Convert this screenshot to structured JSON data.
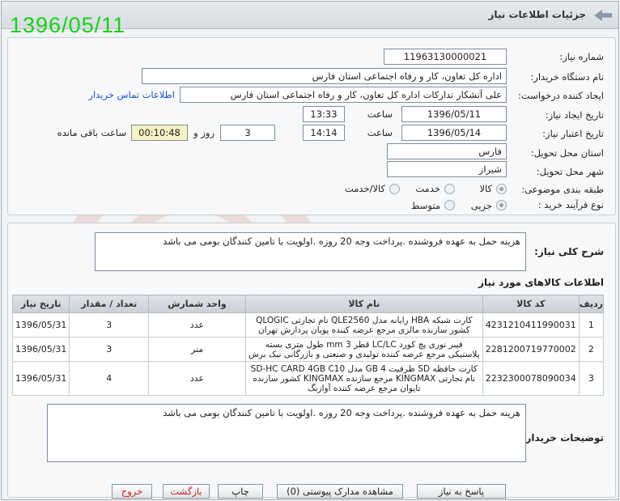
{
  "header": {
    "title": "جزئیات اطلاعات نیاز"
  },
  "date_stamp": "1396/05/11",
  "fields": {
    "need_number": {
      "label": "شماره نیاز:",
      "value": "11963130000021"
    },
    "buyer_org": {
      "label": "نام دستگاه خریدار:",
      "value": "اداره کل تعاون، کار و رفاه اجتماعی استان فارس"
    },
    "requester": {
      "label": "ایجاد کننده درخواست:",
      "value": "علی آتشکار تدارکات اداره کل تعاون، کار و رفاه اجتماعی استان فارس",
      "contact_link": "اطلاعات تماس خریدار"
    },
    "announce_date": {
      "label": "تاریخ ایجاد نیاز:",
      "date": "1396/05/11",
      "time_label": "ساعت",
      "time": "13:33"
    },
    "deadline": {
      "label": "تاریخ اعتبار نیاز:",
      "date": "1396/05/14",
      "time_label": "ساعت",
      "time": "14:14",
      "days": "3",
      "days_label": "روز و",
      "remaining": "00:10:48",
      "remaining_label": "ساعت باقی مانده"
    },
    "province": {
      "label": "استان محل تحویل:",
      "value": "فارس"
    },
    "city": {
      "label": "شهر محل تحویل:",
      "value": "شیراز"
    },
    "category": {
      "label": "طبقه بندی موضوعی:",
      "options": [
        "کالا",
        "خدمت",
        "کالا/خدمت"
      ],
      "selected": "کالا"
    },
    "process": {
      "label": "نوع فرآیند خرید :",
      "options": [
        "جزیی",
        "متوسط"
      ],
      "selected": "جزیی"
    }
  },
  "summary": {
    "label": "شرح کلی نیاز:",
    "text": "هزینه حمل به عهده فروشنده .پرداخت وجه 20 روزه .اولویت با تامین کنندگان بومی می باشد"
  },
  "items_title": "اطلاعات کالاهای مورد نیاز",
  "table": {
    "headers": [
      "ردیف",
      "کد کالا",
      "نام کالا",
      "واحد شمارش",
      "تعداد / مقدار",
      "تاریخ نیاز"
    ],
    "rows": [
      [
        "1",
        "4231210411990031",
        "کارت شبکه HBA رایانه مدل QLE2560 نام تجارتی QLOGIC کشور سازنده مالزی مرجع عرضه کننده پویان پردازش تهران",
        "عدد",
        "3",
        "1396/05/31"
      ],
      [
        "2",
        "2281200719770002",
        "فیبر نوری پچ کورد LC/LC قطر 3 mm طول متری بسته پلاستیکی مرجع عرضه کننده تولیدی و صنعتی و بازرگانی نیک برش",
        "متر",
        "3",
        "1396/05/31"
      ],
      [
        "3",
        "2232300078090034",
        "کارت حافظه SD ظرفیت 4 GB مدل SD-HC CARD 4GB C10 نام تجارتی KINGMAX مرجع سازنده KINGMAX کشور سازنده تایوان مرجع عرضه کننده آوازنگ",
        "عدد",
        "4",
        "1396/05/31"
      ]
    ]
  },
  "buyer_notes": {
    "label": "توضیحات خریدار:",
    "text": "هزینه حمل به عهده فروشنده .پرداخت وجه 20 روزه .اولویت با تامین کنندگان بومی می باشد"
  },
  "buttons": {
    "reply": "پاسخ به نیاز",
    "attachments": "مشاهده مدارک پیوستی (0)",
    "print": "چاپ",
    "back": "بازگشت",
    "exit": "خروج"
  }
}
